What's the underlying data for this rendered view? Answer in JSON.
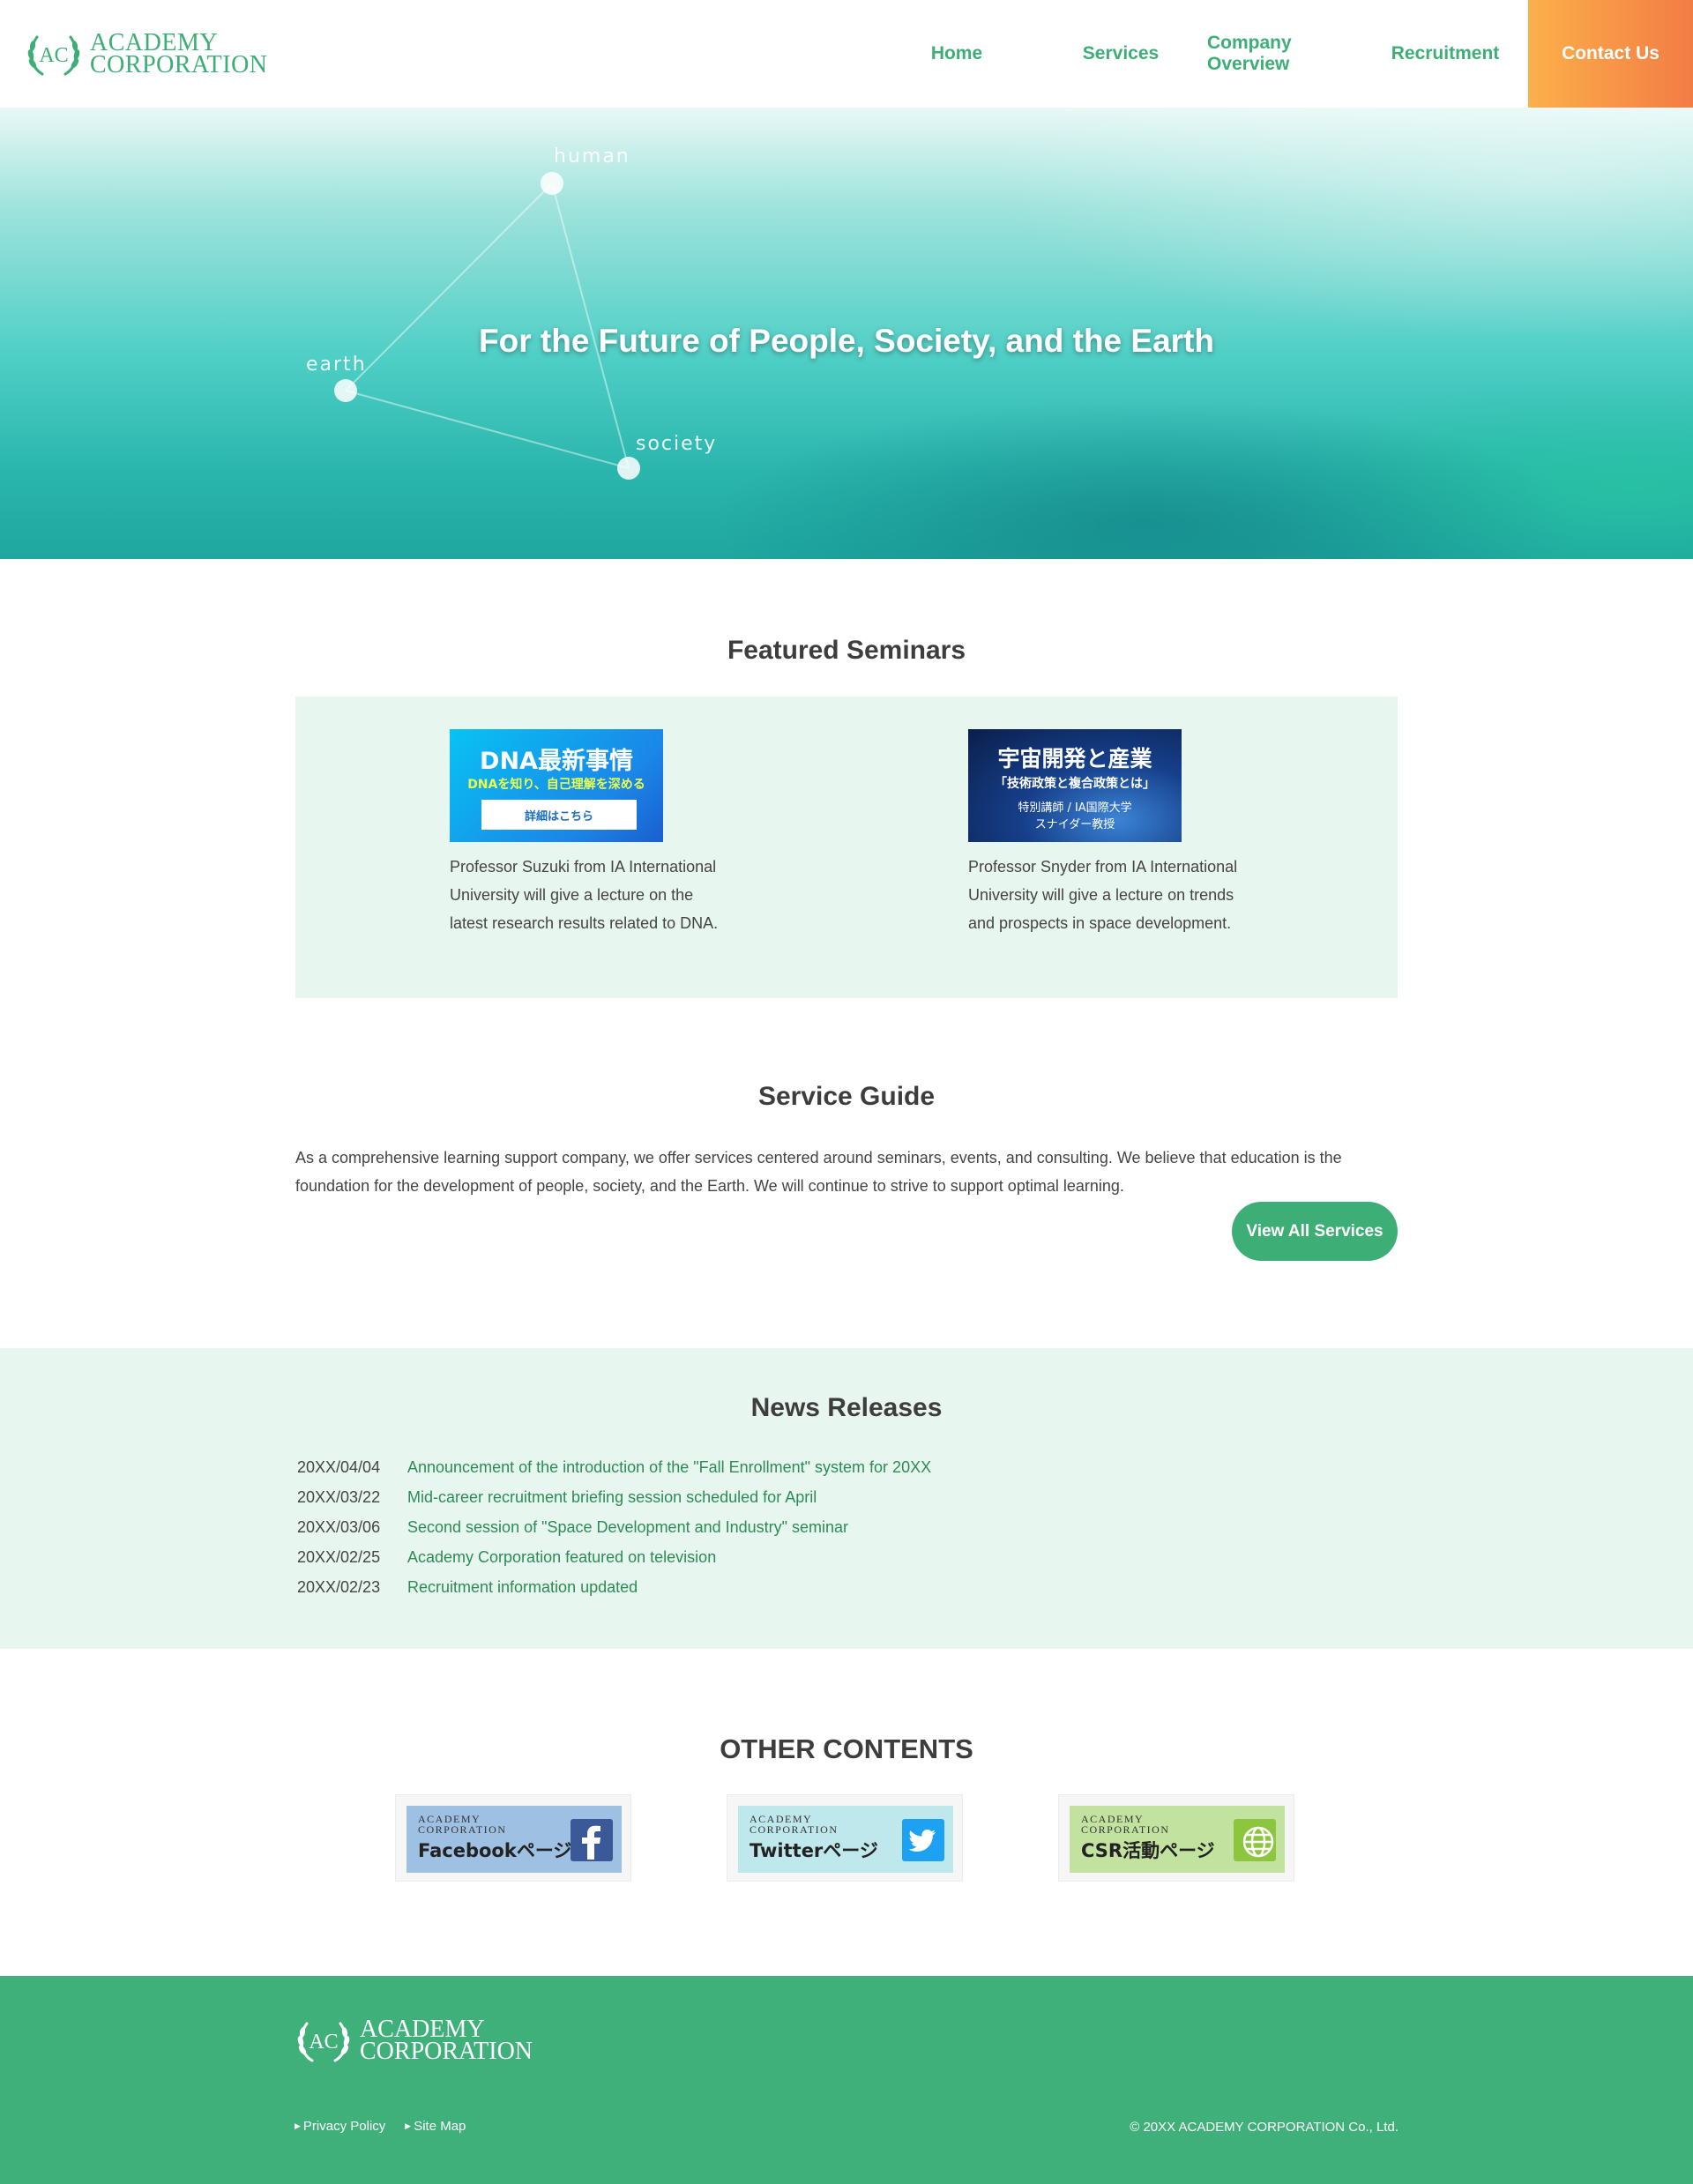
{
  "header": {
    "logo_line1": "ACADEMY",
    "logo_line2": "CORPORATION",
    "logo_monogram": "AC",
    "nav": {
      "home": "Home",
      "services": "Services",
      "company": "Company Overview",
      "recruitment": "Recruitment",
      "contact": "Contact Us"
    }
  },
  "hero": {
    "title": "For the Future of People, Society, and the Earth",
    "nodes": {
      "human": "human",
      "earth": "earth",
      "society": "society"
    }
  },
  "featured": {
    "title": "Featured Seminars",
    "seminars": [
      {
        "image_title": "DNA最新事情",
        "image_subtitle": "DNAを知り、自己理解を深める",
        "image_button": "詳細はこちら",
        "description": "Professor Suzuki from IA International University will give a lecture on the latest research results related to DNA."
      },
      {
        "image_title": "宇宙開発と産業",
        "image_subtitle": "「技術政策と複合政策とは」",
        "image_line3": "特別講師 / IA国際大学",
        "image_line4": "スナイダー教授",
        "description": "Professor Snyder from IA International University will give a lecture on trends and prospects in space development."
      }
    ]
  },
  "service": {
    "title": "Service Guide",
    "text": "As a comprehensive learning support company, we offer services centered around seminars, events, and consulting. We believe that education is the foundation for the development of people, society, and the Earth. We will continue to strive to support optimal learning.",
    "button": "View All Services"
  },
  "news": {
    "title": "News Releases",
    "items": [
      {
        "date": "20XX/04/04",
        "text": "Announcement of the introduction of the \"Fall Enrollment\" system for 20XX"
      },
      {
        "date": "20XX/03/22",
        "text": "Mid-career recruitment briefing session scheduled for April"
      },
      {
        "date": "20XX/03/06",
        "text": "Second session of \"Space Development and Industry\" seminar"
      },
      {
        "date": "20XX/02/25",
        "text": "Academy Corporation featured on television"
      },
      {
        "date": "20XX/02/23",
        "text": "Recruitment information updated"
      }
    ]
  },
  "other": {
    "title": "OTHER CONTENTS",
    "banners": [
      {
        "small1": "ACADEMY",
        "small2": "CORPORATION",
        "label": "Facebookページ",
        "icon": "facebook-icon"
      },
      {
        "small1": "ACADEMY",
        "small2": "CORPORATION",
        "label": "Twitterページ",
        "icon": "twitter-icon"
      },
      {
        "small1": "ACADEMY",
        "small2": "CORPORATION",
        "label": "CSR活動ページ",
        "icon": "globe-icon"
      }
    ]
  },
  "footer": {
    "logo_line1": "ACADEMY",
    "logo_line2": "CORPORATION",
    "logo_monogram": "AC",
    "privacy": "Privacy Policy",
    "sitemap": "Site Map",
    "copyright": "© 20XX ACADEMY CORPORATION Co., Ltd."
  },
  "colors": {
    "brand_green": "#3dae76",
    "light_green_bg": "#e7f6ee",
    "contact_gradient_start": "#fbb04a",
    "contact_gradient_end": "#f37c45",
    "footer_green": "#3fb07a"
  }
}
